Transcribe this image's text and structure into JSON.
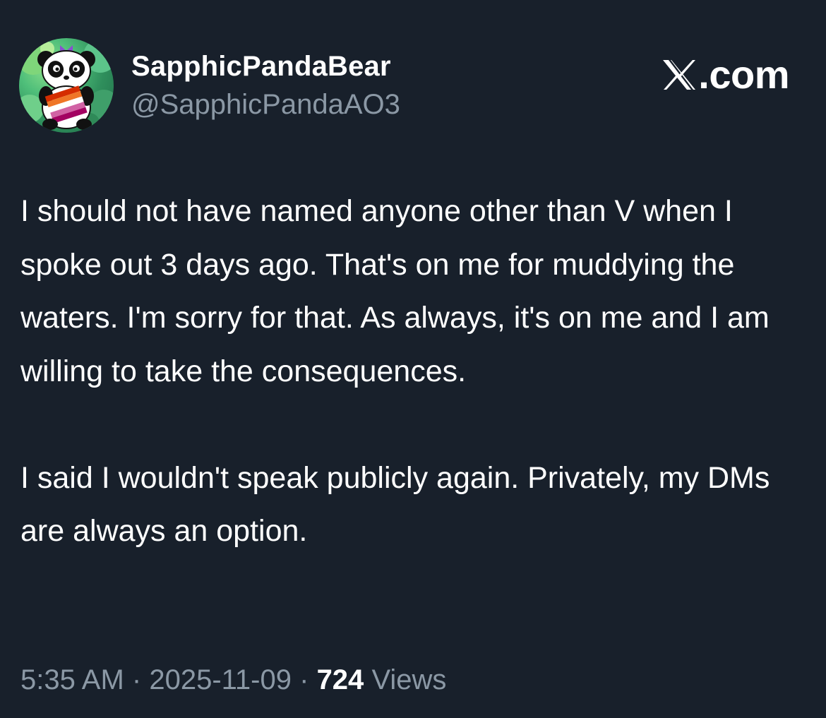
{
  "author": {
    "display_name": "SapphicPandaBear",
    "handle": "@SapphicPandaAO3"
  },
  "brand": {
    "label": ".com",
    "icon": "x-logo-icon"
  },
  "tweet": {
    "paragraphs": [
      "I should not have named anyone other than V when I spoke out 3 days ago. That's on me for muddying the waters. I'm sorry for that. As always, it's on me and I am willing to take the consequences.",
      "I said I wouldn't speak publicly again. Privately, my DMs are always an option."
    ]
  },
  "meta": {
    "time": "5:35 AM",
    "separator": "·",
    "date": "2025-11-09",
    "views_count": "724",
    "views_label": "Views"
  },
  "colors": {
    "background": "#18202b",
    "primary_text": "#ffffff",
    "secondary_text": "#8b98a5"
  }
}
